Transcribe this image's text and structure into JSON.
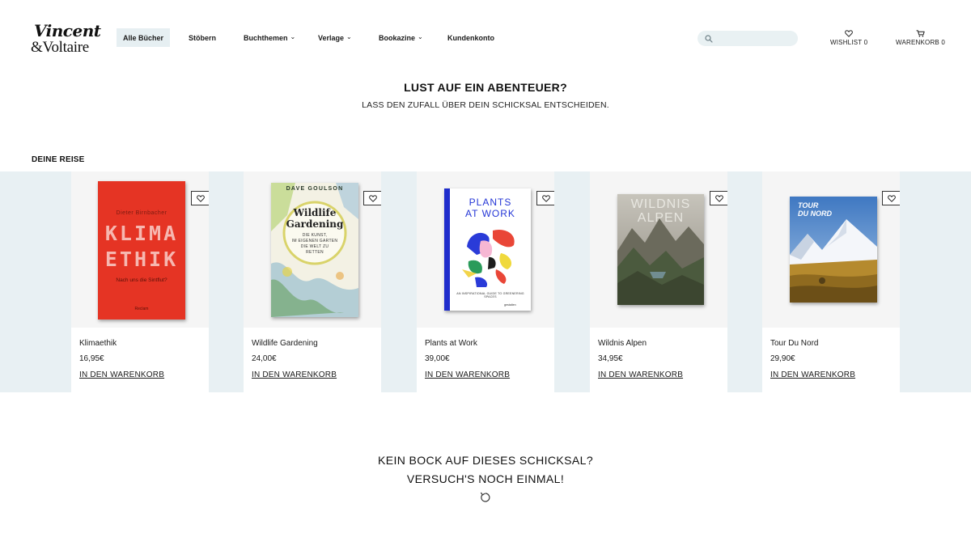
{
  "brand": {
    "line1": "Vincent",
    "line2": "&Voltaire"
  },
  "nav": {
    "items": [
      {
        "label": "Alle Bücher",
        "active": true,
        "dropdown": false
      },
      {
        "label": "Stöbern",
        "active": false,
        "dropdown": false
      },
      {
        "label": "Buchthemen",
        "active": false,
        "dropdown": true
      },
      {
        "label": "Verlage",
        "active": false,
        "dropdown": true
      },
      {
        "label": "Bookazine",
        "active": false,
        "dropdown": true
      },
      {
        "label": "Kundenkonto",
        "active": false,
        "dropdown": false
      }
    ]
  },
  "search": {
    "placeholder": "",
    "value": ""
  },
  "header_links": {
    "wishlist": "WISHLIST 0",
    "cart": "WARENKORB 0"
  },
  "hero": {
    "title": "LUST AUF EIN ABENTEUER?",
    "subtitle": "LASS DEN ZUFALL ÜBER DEIN SCHICKSAL ENTSCHEIDEN."
  },
  "section": {
    "label": "DEINE REISE"
  },
  "products": [
    {
      "title": "Klimaethik",
      "price": "16,95€",
      "cta": "IN DEN WARENKORB",
      "cover": {
        "author": "Dieter Birnbacher",
        "line1": "KLIMA",
        "line2": "ETHIK",
        "tagline": "Nach uns die Sintflut?",
        "publisher": "Reclam"
      }
    },
    {
      "title": "Wildlife Gardening",
      "price": "24,00€",
      "cta": "IN DEN WARENKORB",
      "cover": {
        "author": "DAVE GOULSON",
        "line1": "Wildlife",
        "line2": "Gardening",
        "tagline1": "DIE KUNST,",
        "tagline2": "IM EIGENEN GARTEN",
        "tagline3": "DIE WELT ZU",
        "tagline4": "RETTEN"
      }
    },
    {
      "title": "Plants at Work",
      "price": "39,00€",
      "cta": "IN DEN WARENKORB",
      "cover": {
        "line1": "PLANTS",
        "line2": "AT WORK",
        "tagline": "AN INSPIRATIONAL GUIDE TO GREENERING SPACES",
        "publisher": "gestalten"
      }
    },
    {
      "title": "Wildnis Alpen",
      "price": "34,95€",
      "cta": "IN DEN WARENKORB",
      "cover": {
        "line1": "WILDNIS",
        "line2": "ALPEN"
      }
    },
    {
      "title": "Tour Du Nord",
      "price": "29,90€",
      "cta": "IN DEN WARENKORB",
      "cover": {
        "line1": "TOUR",
        "line2": "DU NORD"
      }
    }
  ],
  "cta": {
    "line1": "KEIN BOCK AUF DIESES SCHICKSAL?",
    "line2": "VERSUCH'S NOCH EINMAL!"
  },
  "icons": {
    "search": "search-icon",
    "wishlist": "heart-icon",
    "cart": "cart-icon",
    "retry": "refresh-icon"
  },
  "colors": {
    "accent_bg": "#e8f0f3",
    "nav_active_bg": "#e6eff2",
    "text": "#1a1a1a"
  }
}
